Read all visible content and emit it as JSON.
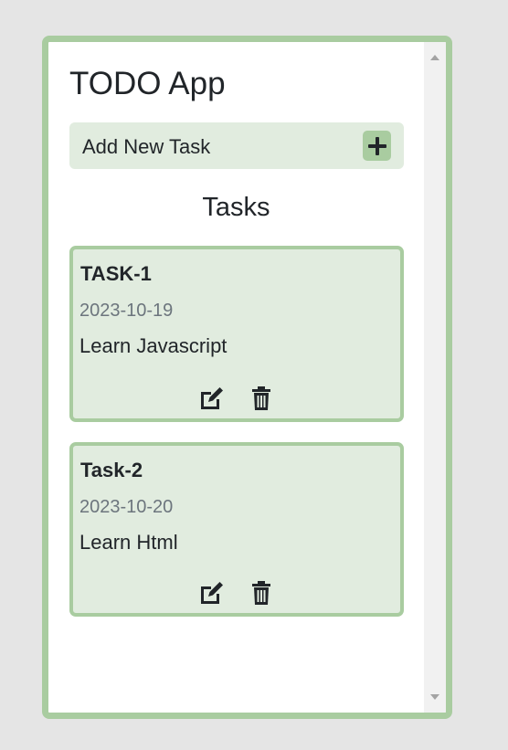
{
  "app": {
    "title": "TODO App"
  },
  "add_task": {
    "label": "Add New Task",
    "button_icon": "plus-icon"
  },
  "tasks_heading": "Tasks",
  "tasks": [
    {
      "title": "TASK-1",
      "date": "2023-10-19",
      "description": "Learn Javascript",
      "edit_icon": "edit-icon",
      "delete_icon": "trash-icon"
    },
    {
      "title": "Task-2",
      "date": "2023-10-20",
      "description": "Learn Html",
      "edit_icon": "edit-icon",
      "delete_icon": "trash-icon"
    }
  ],
  "colors": {
    "accent": "#a9cca0",
    "card_background": "#e1ecdf",
    "text": "#212529",
    "muted_text": "#6c757d"
  }
}
